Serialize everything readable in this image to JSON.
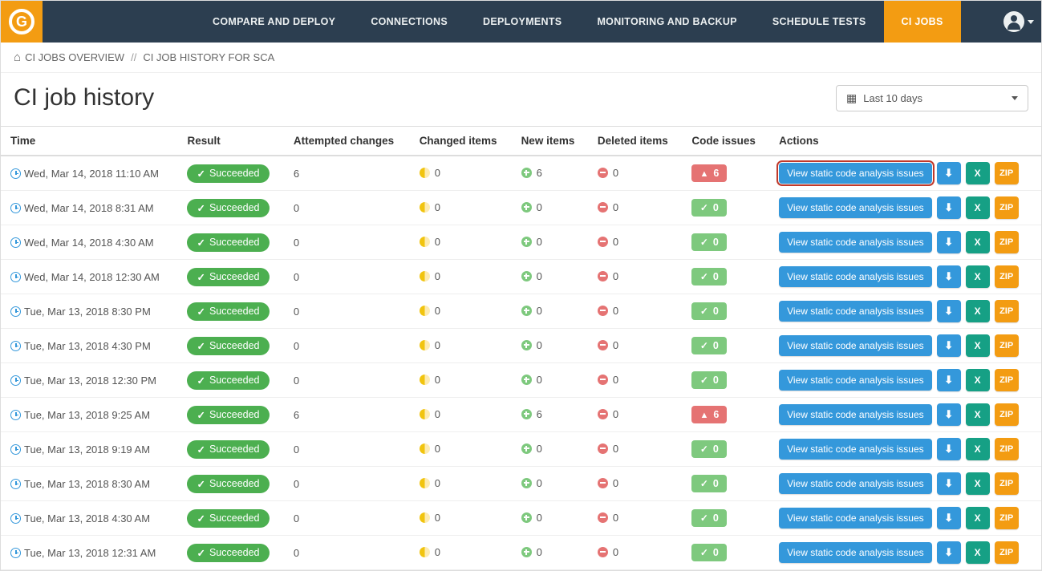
{
  "nav": {
    "items": [
      "COMPARE AND DEPLOY",
      "CONNECTIONS",
      "DEPLOYMENTS",
      "MONITORING AND BACKUP",
      "SCHEDULE TESTS",
      "CI JOBS"
    ],
    "activeIndex": 5
  },
  "breadcrumb": {
    "root": "CI JOBS OVERVIEW",
    "current": "CI JOB HISTORY FOR SCA"
  },
  "page": {
    "title": "CI job history",
    "filterLabel": "Last 10 days"
  },
  "table": {
    "headers": [
      "Time",
      "Result",
      "Attempted changes",
      "Changed items",
      "New items",
      "Deleted items",
      "Code issues",
      "Actions"
    ],
    "viewBtnLabel": "View static code analysis issues",
    "zipLabel": "ZIP",
    "rows": [
      {
        "time": "Wed, Mar 14, 2018 11:10 AM",
        "result": "Succeeded",
        "attempted": "6",
        "changed": "0",
        "new": "6",
        "deleted": "0",
        "issues": "6",
        "issuesWarn": true,
        "highlighted": true
      },
      {
        "time": "Wed, Mar 14, 2018 8:31 AM",
        "result": "Succeeded",
        "attempted": "0",
        "changed": "0",
        "new": "0",
        "deleted": "0",
        "issues": "0",
        "issuesWarn": false
      },
      {
        "time": "Wed, Mar 14, 2018 4:30 AM",
        "result": "Succeeded",
        "attempted": "0",
        "changed": "0",
        "new": "0",
        "deleted": "0",
        "issues": "0",
        "issuesWarn": false
      },
      {
        "time": "Wed, Mar 14, 2018 12:30 AM",
        "result": "Succeeded",
        "attempted": "0",
        "changed": "0",
        "new": "0",
        "deleted": "0",
        "issues": "0",
        "issuesWarn": false
      },
      {
        "time": "Tue, Mar 13, 2018 8:30 PM",
        "result": "Succeeded",
        "attempted": "0",
        "changed": "0",
        "new": "0",
        "deleted": "0",
        "issues": "0",
        "issuesWarn": false
      },
      {
        "time": "Tue, Mar 13, 2018 4:30 PM",
        "result": "Succeeded",
        "attempted": "0",
        "changed": "0",
        "new": "0",
        "deleted": "0",
        "issues": "0",
        "issuesWarn": false
      },
      {
        "time": "Tue, Mar 13, 2018 12:30 PM",
        "result": "Succeeded",
        "attempted": "0",
        "changed": "0",
        "new": "0",
        "deleted": "0",
        "issues": "0",
        "issuesWarn": false
      },
      {
        "time": "Tue, Mar 13, 2018 9:25 AM",
        "result": "Succeeded",
        "attempted": "6",
        "changed": "0",
        "new": "6",
        "deleted": "0",
        "issues": "6",
        "issuesWarn": true
      },
      {
        "time": "Tue, Mar 13, 2018 9:19 AM",
        "result": "Succeeded",
        "attempted": "0",
        "changed": "0",
        "new": "0",
        "deleted": "0",
        "issues": "0",
        "issuesWarn": false
      },
      {
        "time": "Tue, Mar 13, 2018 8:30 AM",
        "result": "Succeeded",
        "attempted": "0",
        "changed": "0",
        "new": "0",
        "deleted": "0",
        "issues": "0",
        "issuesWarn": false
      },
      {
        "time": "Tue, Mar 13, 2018 4:30 AM",
        "result": "Succeeded",
        "attempted": "0",
        "changed": "0",
        "new": "0",
        "deleted": "0",
        "issues": "0",
        "issuesWarn": false
      },
      {
        "time": "Tue, Mar 13, 2018 12:31 AM",
        "result": "Succeeded",
        "attempted": "0",
        "changed": "0",
        "new": "0",
        "deleted": "0",
        "issues": "0",
        "issuesWarn": false
      }
    ]
  }
}
